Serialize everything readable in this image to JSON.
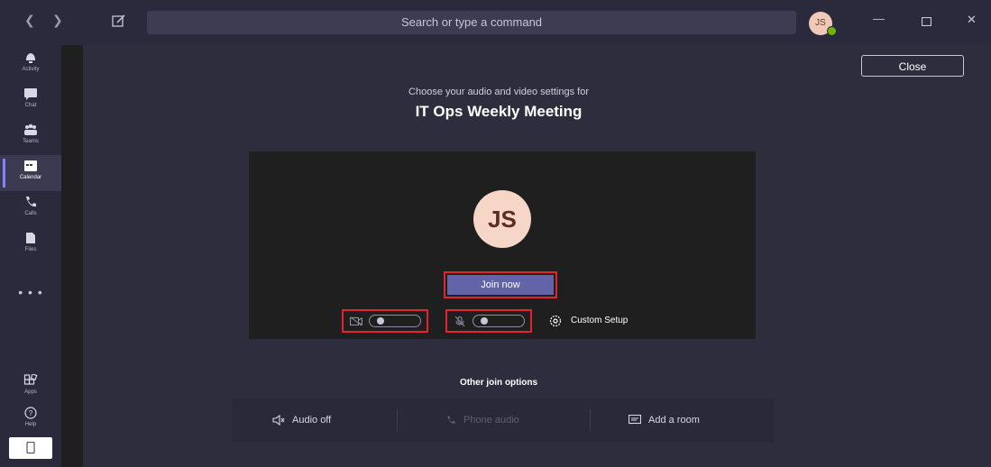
{
  "titlebar": {
    "back_icon": "chevron-left-icon",
    "forward_icon": "chevron-right-icon",
    "compose_icon": "compose-icon",
    "search_placeholder": "Search or type a command",
    "avatar_initials": "JS",
    "presence_color": "#6bb700",
    "minimize_icon": "minimize-icon",
    "maximize_icon": "maximize-icon",
    "close_icon": "close-icon"
  },
  "rail": {
    "items": [
      {
        "label": "Activity",
        "icon": "bell-icon"
      },
      {
        "label": "Chat",
        "icon": "chat-icon"
      },
      {
        "label": "Teams",
        "icon": "teams-icon"
      },
      {
        "label": "Calendar",
        "icon": "calendar-icon",
        "active": true
      },
      {
        "label": "Calls",
        "icon": "phone-icon"
      },
      {
        "label": "Files",
        "icon": "file-icon"
      }
    ],
    "more_label": "• • •",
    "bottom_items": [
      {
        "label": "Apps",
        "icon": "apps-icon"
      },
      {
        "label": "Help",
        "icon": "help-icon"
      }
    ],
    "device_icon": "mobile-device-icon"
  },
  "main": {
    "close_label": "Close",
    "subtitle": "Choose your audio and video settings for",
    "meeting_title": "IT Ops Weekly Meeting",
    "preview": {
      "avatar_initials": "JS",
      "join_label": "Join now",
      "video_toggle": {
        "icon": "video-camera-icon",
        "on": false
      },
      "mic_toggle": {
        "icon": "microphone-icon",
        "on": false
      },
      "custom_setup_label": "Custom Setup",
      "custom_setup_icon": "gear-icon"
    },
    "other_options": {
      "heading": "Other join options",
      "items": [
        {
          "label": "Audio off",
          "icon": "speaker-muted-icon",
          "enabled": true
        },
        {
          "label": "Phone audio",
          "icon": "phone-icon",
          "enabled": false
        },
        {
          "label": "Add a room",
          "icon": "cast-room-icon",
          "enabled": true
        }
      ]
    }
  },
  "colors": {
    "accent": "#6264a7",
    "highlight_border": "#e2242e",
    "avatar_bg": "#f5d6c7"
  }
}
